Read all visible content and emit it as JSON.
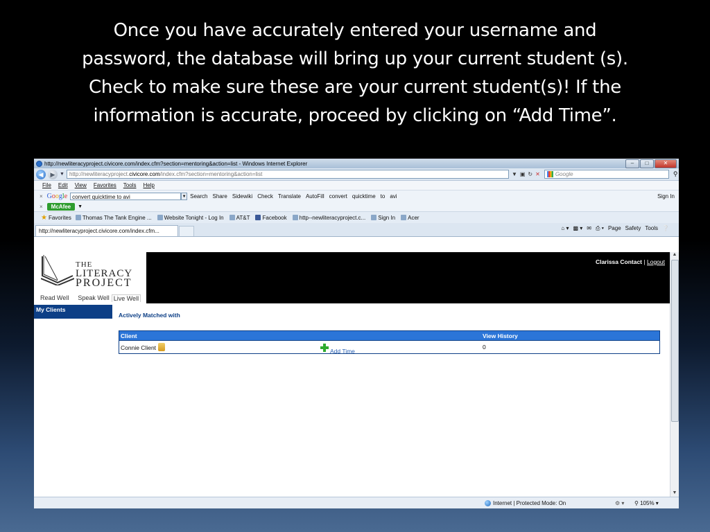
{
  "caption": [
    "Once you have accurately entered your username and",
    "password, the database will bring up your current student (s).",
    "Check to make sure these are your current student(s)!  If the",
    "information is accurate, proceed by clicking on “Add Time”."
  ],
  "browser": {
    "title": "http://newliteracyproject.civicore.com/index.cfm?section=mentoring&action=list - Windows Internet Explorer",
    "address_prefix": "http://newliteracyproject.",
    "address_domain": "civicore.com",
    "address_suffix": "/index.cfm?section=mentoring&action=list",
    "search_placeholder": "Google",
    "menu": [
      "File",
      "Edit",
      "View",
      "Favorites",
      "Tools",
      "Help"
    ],
    "google_toolbar": {
      "query": "convert quicktime to avi",
      "items": [
        "Search",
        "Share",
        "Sidewiki",
        "Check",
        "Translate",
        "AutoFill",
        "convert",
        "quicktime",
        "to",
        "avi"
      ],
      "signin": "Sign In"
    },
    "mcafee": "McAfee",
    "favorites_label": "Favorites",
    "favorites": [
      "Thomas The Tank Engine ...",
      "Website Tonight - Log In",
      "AT&T",
      "Facebook",
      "http--newliteracyproject.c...",
      "Sign In",
      "Acer"
    ],
    "tab_title": "http://newliteracyproject.civicore.com/index.cfm...",
    "commands": [
      "Page",
      "Safety",
      "Tools"
    ],
    "status": {
      "zone": "Internet | Protected Mode: On",
      "zoom": "105%"
    }
  },
  "site": {
    "logo": [
      "THE",
      "LITERACY",
      "PROJECT"
    ],
    "nav": [
      "Read Well",
      "Speak Well",
      "Live Well"
    ],
    "user_name": "Clarissa Contact",
    "separator": "|",
    "logout": "Logout",
    "sidebar_item": "My Clients",
    "section_title": "Actively Matched with",
    "table": {
      "headers": [
        "Client",
        "",
        "View History"
      ],
      "rows": [
        {
          "client": "Connie Client",
          "action": "Add Time",
          "history": "0"
        }
      ]
    }
  }
}
